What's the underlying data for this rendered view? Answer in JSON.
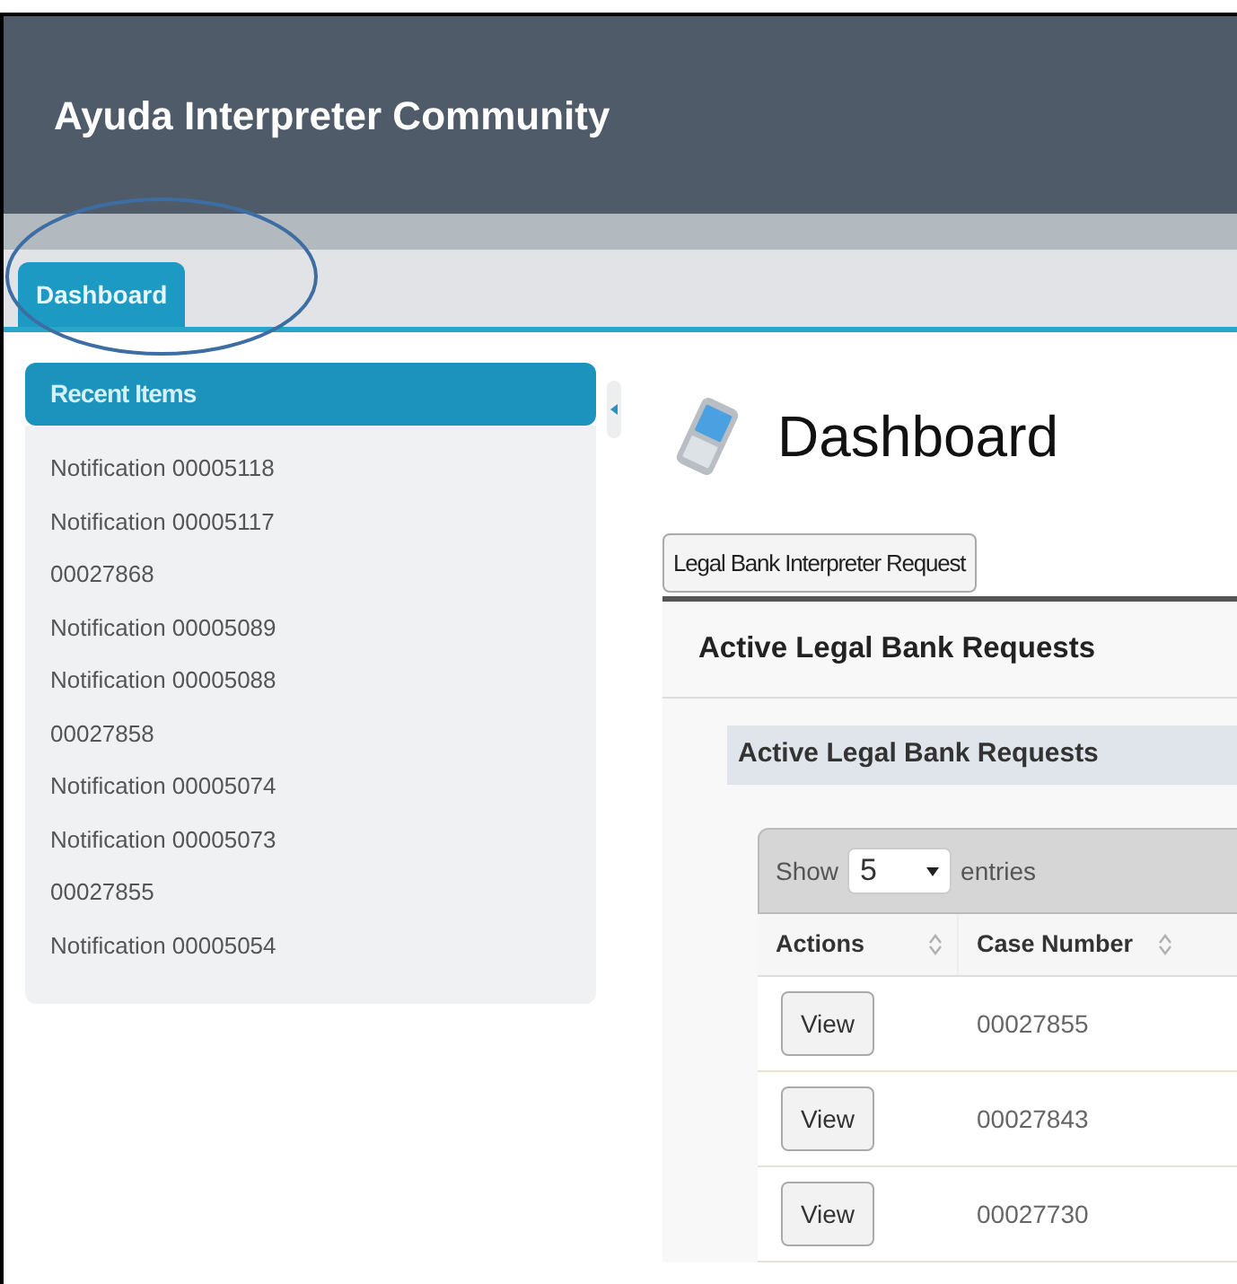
{
  "header": {
    "title": "Ayuda Interpreter Community"
  },
  "tabs": [
    {
      "label": "Dashboard",
      "selected": true
    }
  ],
  "sidebar": {
    "title": "Recent Items",
    "items": [
      "Notification 00005118",
      "Notification 00005117",
      "00027868",
      "Notification 00005089",
      "Notification 00005088",
      "00027858",
      "Notification 00005074",
      "Notification 00005073",
      "00027855",
      "Notification 00005054"
    ]
  },
  "page": {
    "title": "Dashboard",
    "action_button": "Legal Bank Interpreter Request",
    "panel": {
      "title": "Active Legal Bank Requests",
      "subtitle": "Active Legal Bank Requests",
      "length": {
        "show": "Show",
        "value": "5",
        "entries": "entries"
      },
      "table": {
        "columns": [
          "Actions",
          "Case Number"
        ],
        "rows": [
          {
            "action": "View",
            "case_number": "00027855"
          },
          {
            "action": "View",
            "case_number": "00027843"
          },
          {
            "action": "View",
            "case_number": "00027730"
          }
        ]
      }
    }
  }
}
